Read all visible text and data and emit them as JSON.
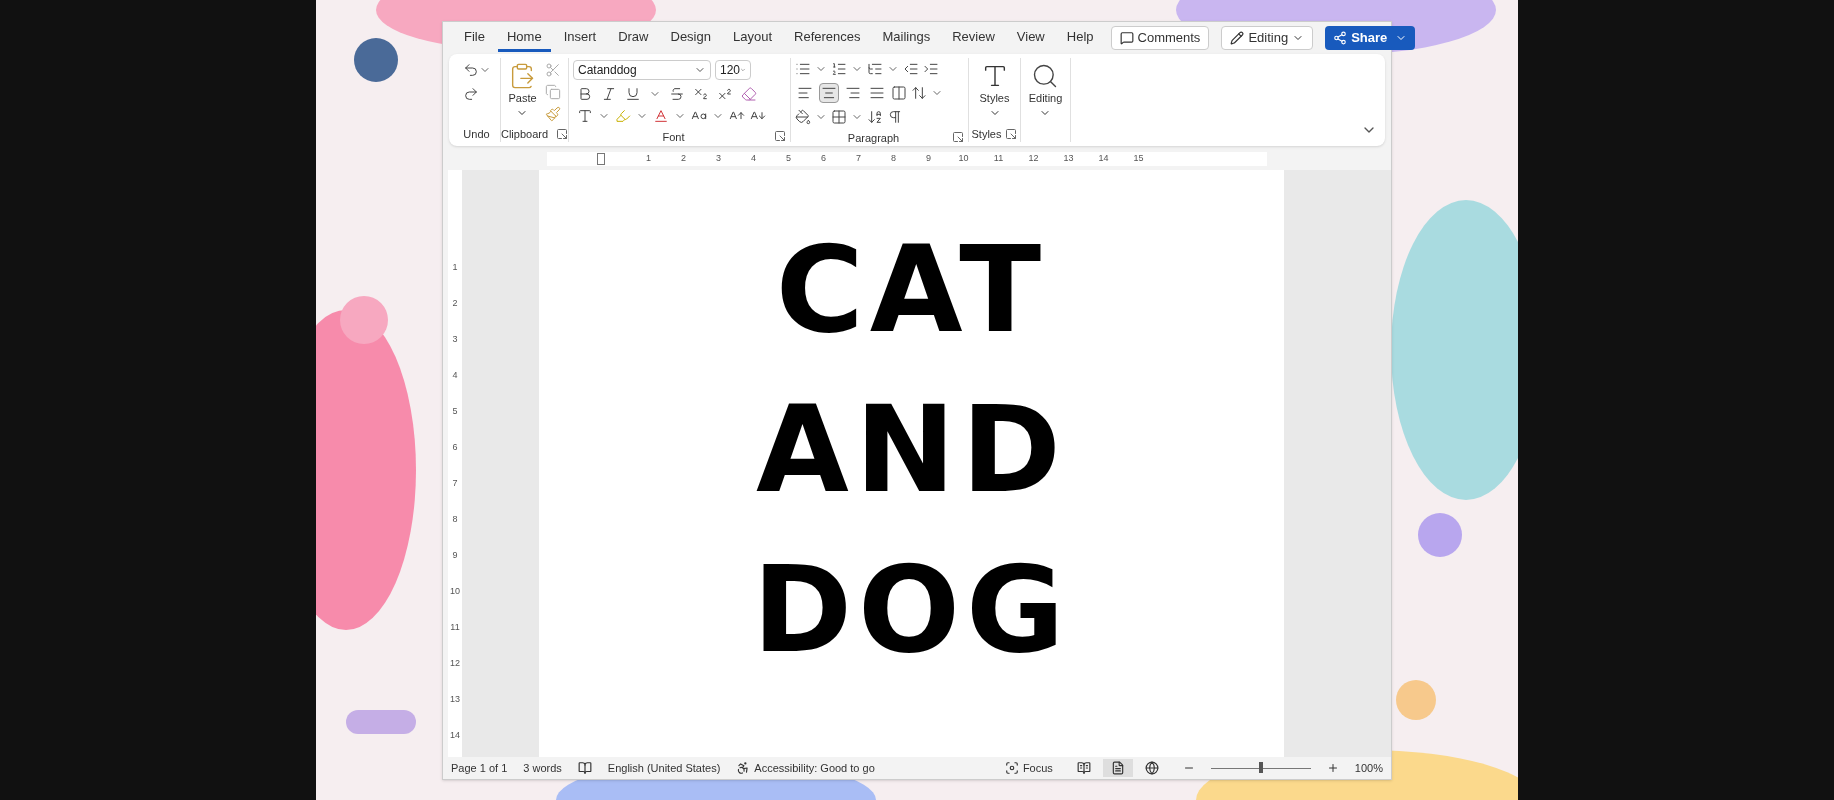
{
  "tabs": [
    {
      "label": "File",
      "selected": false
    },
    {
      "label": "Home",
      "selected": true
    },
    {
      "label": "Insert",
      "selected": false
    },
    {
      "label": "Draw",
      "selected": false
    },
    {
      "label": "Design",
      "selected": false
    },
    {
      "label": "Layout",
      "selected": false
    },
    {
      "label": "References",
      "selected": false
    },
    {
      "label": "Mailings",
      "selected": false
    },
    {
      "label": "Review",
      "selected": false
    },
    {
      "label": "View",
      "selected": false
    },
    {
      "label": "Help",
      "selected": false
    }
  ],
  "top_buttons": {
    "comments": "Comments",
    "editing": "Editing",
    "share": "Share"
  },
  "ribbon": {
    "undo": {
      "label": "Undo"
    },
    "clipboard": {
      "paste": "Paste",
      "label": "Clipboard"
    },
    "font": {
      "name": "Catanddog",
      "size": "120",
      "label": "Font"
    },
    "paragraph": {
      "label": "Paragraph",
      "alignments": [
        {
          "kind": "left",
          "selected": false
        },
        {
          "kind": "center",
          "selected": true
        },
        {
          "kind": "right",
          "selected": false
        },
        {
          "kind": "justify",
          "selected": false
        }
      ]
    },
    "styles": {
      "button": "Styles",
      "label": "Styles"
    },
    "editing": {
      "button": "Editing"
    }
  },
  "ruler": {
    "horizontal": [
      "1",
      "2",
      "3",
      "4",
      "5",
      "6",
      "7",
      "8",
      "9",
      "10",
      "11",
      "12",
      "13",
      "14",
      "15"
    ],
    "vertical": [
      "1",
      "2",
      "3",
      "4",
      "5",
      "6",
      "7",
      "8",
      "9",
      "10",
      "11",
      "12",
      "13",
      "14"
    ]
  },
  "document": {
    "lines": [
      "CAT",
      "AND",
      "DOG"
    ]
  },
  "status_bar": {
    "page": "Page 1 of 1",
    "words": "3 words",
    "language": "English (United States)",
    "accessibility": "Accessibility: Good to go",
    "focus": "Focus",
    "views": [
      {
        "kind": "read",
        "selected": false
      },
      {
        "kind": "print",
        "selected": true
      },
      {
        "kind": "web",
        "selected": false
      }
    ],
    "zoom": {
      "level": 0.5,
      "reading": "100%"
    }
  }
}
